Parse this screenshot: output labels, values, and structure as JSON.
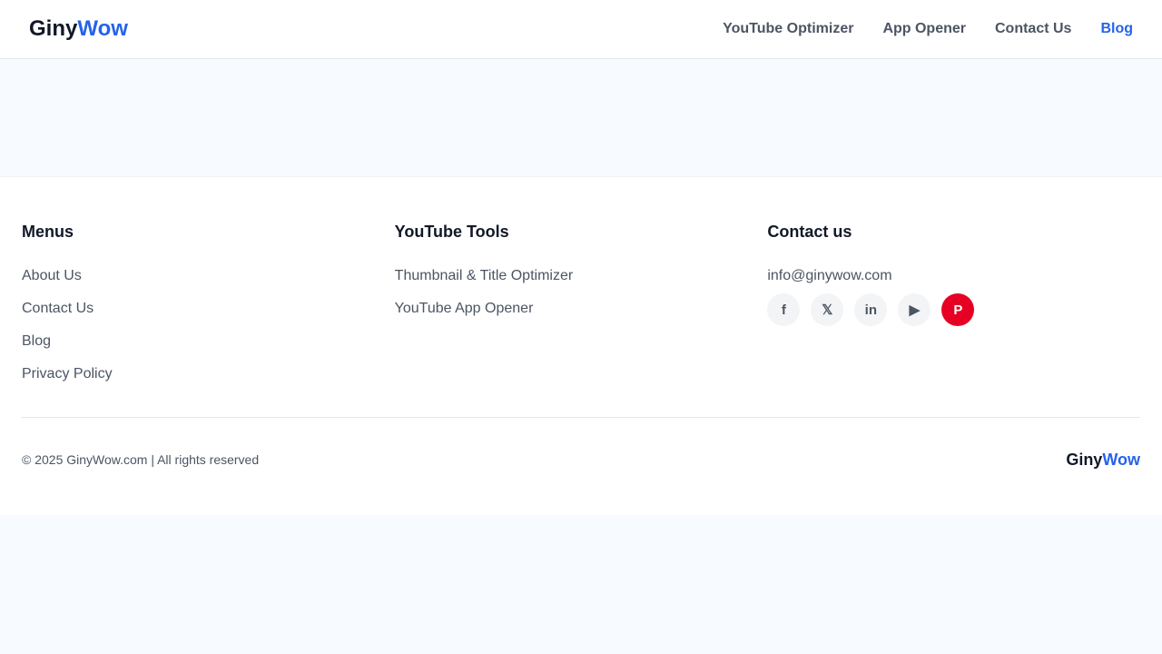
{
  "header": {
    "logo_a": "Giny",
    "logo_b": "Wow",
    "nav": [
      {
        "label": "YouTube Optimizer"
      },
      {
        "label": "App Opener"
      },
      {
        "label": "Contact Us"
      },
      {
        "label": "Blog"
      }
    ]
  },
  "footer": {
    "menus": {
      "title": "Menus",
      "items": [
        "About Us",
        "Contact Us",
        "Blog",
        "Privacy Policy"
      ]
    },
    "tools": {
      "title": "YouTube Tools",
      "items": [
        "Thumbnail & Title Optimizer",
        "YouTube App Opener"
      ]
    },
    "contact": {
      "title": "Contact us",
      "email": "info@ginywow.com",
      "social": [
        "facebook-icon",
        "x-icon",
        "linkedin-icon",
        "youtube-icon",
        "pinterest-icon"
      ]
    },
    "copyright": "© 2025 GinyWow.com | All rights reserved",
    "logo_a": "Giny",
    "logo_b": "Wow"
  },
  "colors": {
    "accent": "#2563eb",
    "pinterest": "#e60023"
  }
}
